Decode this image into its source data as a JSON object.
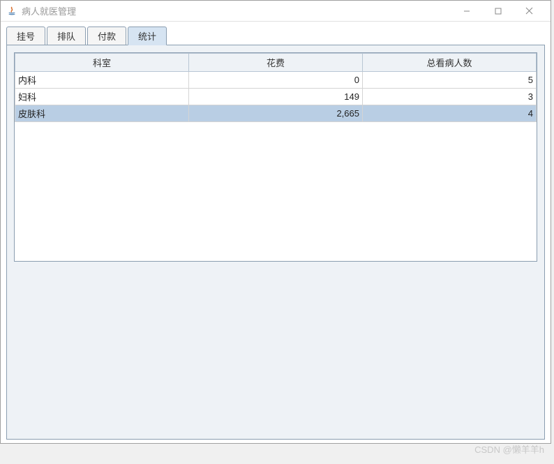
{
  "window": {
    "title": "病人就医管理"
  },
  "tabs": [
    {
      "label": "挂号",
      "active": false
    },
    {
      "label": "排队",
      "active": false
    },
    {
      "label": "付款",
      "active": false
    },
    {
      "label": "统计",
      "active": true
    }
  ],
  "table": {
    "columns": [
      "科室",
      "花费",
      "总看病人数"
    ],
    "rows": [
      {
        "dept": "内科",
        "cost": "0",
        "count": "5",
        "selected": false
      },
      {
        "dept": "妇科",
        "cost": "149",
        "count": "3",
        "selected": false
      },
      {
        "dept": "皮肤科",
        "cost": "2,665",
        "count": "4",
        "selected": true
      }
    ]
  },
  "watermark": "CSDN @懒羊羊h"
}
